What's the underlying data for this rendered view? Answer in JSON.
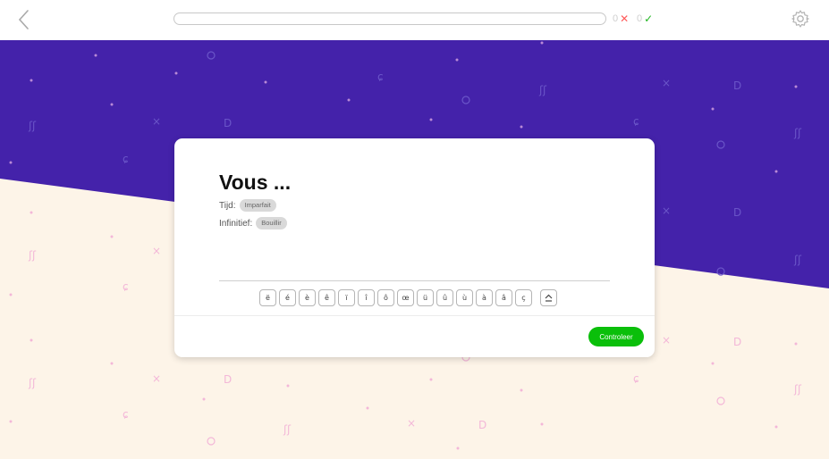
{
  "topbar": {
    "wrong_count": "0",
    "right_count": "0",
    "progress": 0
  },
  "exercise": {
    "question": "Vous ...",
    "tense_label": "Tijd:",
    "tense_value": "Imparfait",
    "infinitive_label": "Infinitief:",
    "infinitive_value": "Bouillir",
    "answer_value": ""
  },
  "keyboard": {
    "keys": [
      "ë",
      "é",
      "è",
      "ê",
      "ï",
      "î",
      "ô",
      "œ",
      "ü",
      "û",
      "ù",
      "à",
      "â",
      "ç"
    ]
  },
  "actions": {
    "check_label": "Controleer"
  },
  "icons": {
    "back": "chevron-left-icon",
    "wrong": "cross-icon",
    "right": "checkmark-icon",
    "settings": "gear-icon",
    "shift": "shift-icon"
  },
  "colors": {
    "purple_bg": "#4422aa",
    "cream_bg": "#fdf4e8",
    "check_button": "#0abf0a",
    "wrong": "#ff5a5a",
    "right": "#21b621"
  }
}
